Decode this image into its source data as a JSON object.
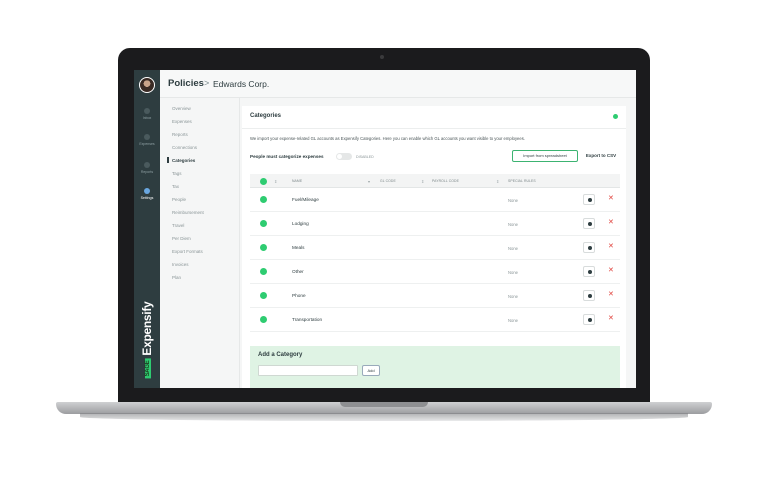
{
  "header": {
    "title": "Policies",
    "separator": ">",
    "company": "Edwards Corp."
  },
  "nav": {
    "items": [
      {
        "label": "Inbox",
        "active": false
      },
      {
        "label": "Expenses",
        "active": false
      },
      {
        "label": "Reports",
        "active": false
      },
      {
        "label": "Settings",
        "active": true
      }
    ]
  },
  "brand": {
    "mark": "SAGE",
    "name": "Expensify"
  },
  "sidebar": {
    "items": [
      {
        "label": "Overview"
      },
      {
        "label": "Expenses"
      },
      {
        "label": "Reports"
      },
      {
        "label": "Connections"
      },
      {
        "label": "Categories",
        "active": true
      },
      {
        "label": "Tags"
      },
      {
        "label": "Tax"
      },
      {
        "label": "People"
      },
      {
        "label": "Reimbursement"
      },
      {
        "label": "Travel"
      },
      {
        "label": "Per Diem"
      },
      {
        "label": "Export Formats"
      },
      {
        "label": "Invoices"
      },
      {
        "label": "Plan"
      }
    ]
  },
  "card": {
    "title": "Categories",
    "intro": "We import your expense-related GL accounts as Expensify Categories. Here you can enable which GL accounts you want visible to your employees.",
    "require_label": "People must categorize expenses",
    "toggle_state": "DISABLED",
    "import_button": "Import from spreadsheet",
    "export_button": "Export to CSV"
  },
  "table": {
    "headers": {
      "name": "NAME",
      "gl_code": "GL CODE",
      "payroll_code": "PAYROLL CODE",
      "special_rules": "SPECIAL RULES"
    },
    "rows": [
      {
        "name": "Fuel/Mileage",
        "special": "None"
      },
      {
        "name": "Lodging",
        "special": "None"
      },
      {
        "name": "Meals",
        "special": "None"
      },
      {
        "name": "Other",
        "special": "None"
      },
      {
        "name": "Phone",
        "special": "None"
      },
      {
        "name": "Transportation",
        "special": "None"
      }
    ],
    "remove_glyph": "✕"
  },
  "add_category": {
    "title": "Add a Category",
    "input_value": "",
    "button": "Add"
  },
  "colors": {
    "accent": "#2ecc71",
    "nav_bg": "#2e3d40",
    "remove": "#e0413b",
    "add_panel": "#dff3e4"
  }
}
